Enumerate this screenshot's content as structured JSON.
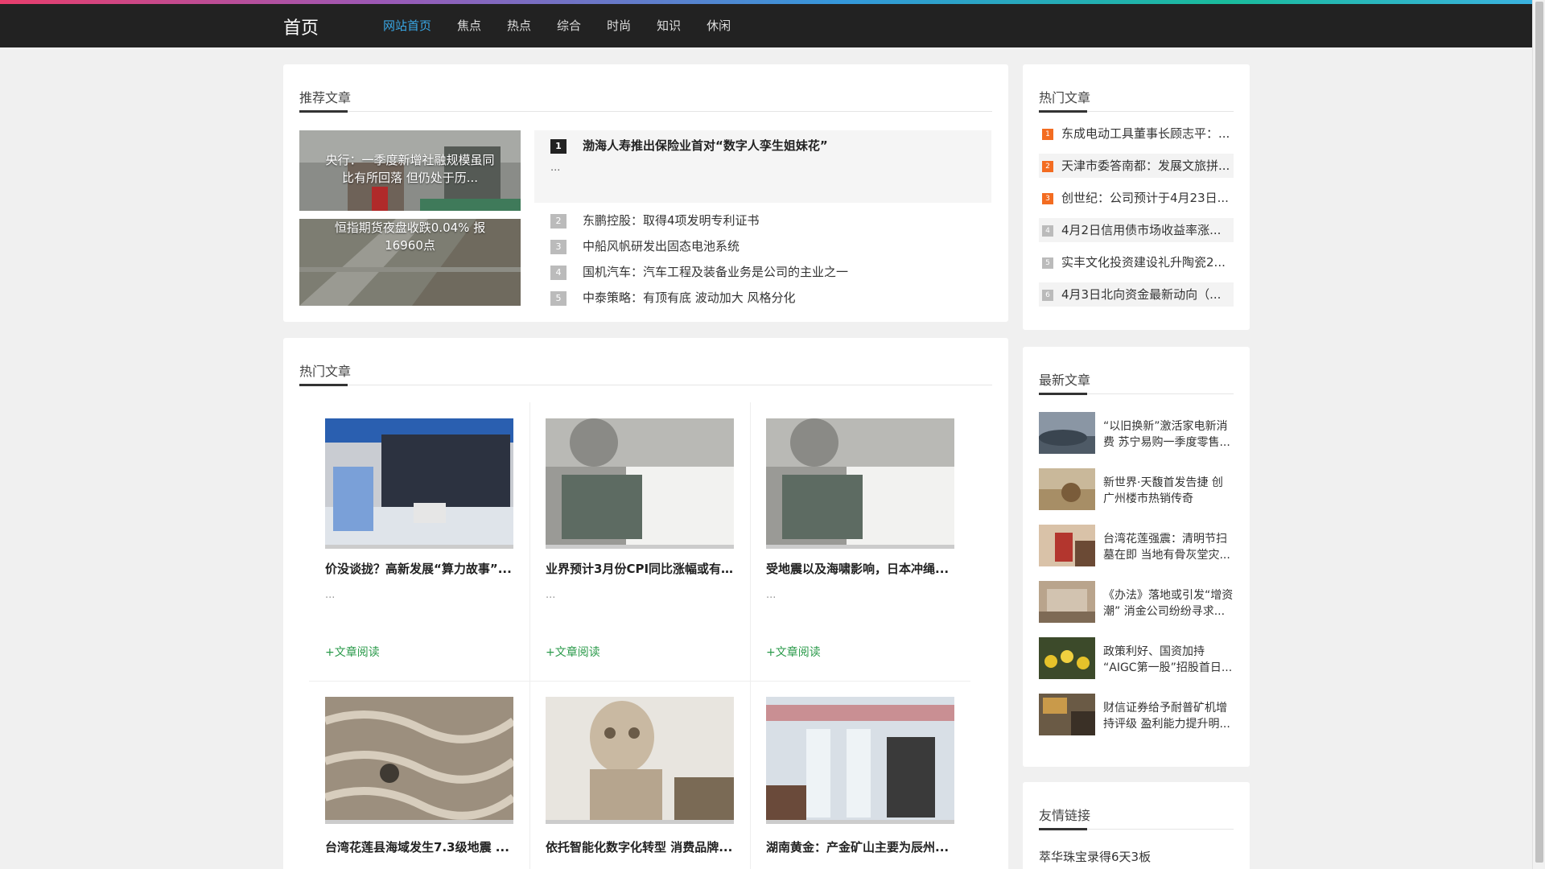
{
  "header": {
    "logo": "首页",
    "nav": [
      "网站首页",
      "焦点",
      "热点",
      "综合",
      "时尚",
      "知识",
      "休闲"
    ]
  },
  "recommend": {
    "title": "推荐文章",
    "images": [
      {
        "caption": "央行：一季度新增社融规模虽同比有所回落 但仍处于历..."
      },
      {
        "caption": "恒指期货夜盘收跌0.04% 报16960点"
      }
    ],
    "first": {
      "num": "1",
      "title": "渤海人寿推出保险业首对“数字人孪生姐妹花”",
      "desc": "..."
    },
    "items": [
      {
        "num": "2",
        "title": "东鹏控股：取得4项发明专利证书"
      },
      {
        "num": "3",
        "title": "中船风帆研发出固态电池系统"
      },
      {
        "num": "4",
        "title": "国机汽车：汽车工程及装备业务是公司的主业之一"
      },
      {
        "num": "5",
        "title": "中泰策略：有顶有底 波动加大 风格分化"
      }
    ]
  },
  "hot": {
    "title": "热门文章",
    "more_label": "+文章阅读",
    "cards": [
      {
        "title": "价没谈拢？高新发展“算力故事”...",
        "desc": "..."
      },
      {
        "title": "业界预计3月份CPI同比涨幅或有...",
        "desc": "..."
      },
      {
        "title": "受地震以及海啸影响，日本冲绳...",
        "desc": "..."
      },
      {
        "title": "台湾花莲县海域发生7.3级地震 ...",
        "desc": ""
      },
      {
        "title": "依托智能化数字化转型 消费品牌...",
        "desc": ""
      },
      {
        "title": "湖南黄金：产金矿山主要为辰州...",
        "desc": ""
      }
    ]
  },
  "side_hot": {
    "title": "热门文章",
    "items": [
      {
        "num": "1",
        "title": "东成电动工具董事长顾志平：..."
      },
      {
        "num": "2",
        "title": "天津市委答南都：发展文旅拼..."
      },
      {
        "num": "3",
        "title": "创世纪：公司预计于4月23日..."
      },
      {
        "num": "4",
        "title": "4月2日信用债市场收益率涨..."
      },
      {
        "num": "5",
        "title": "实丰文化投资建设礼升陶瓷2..."
      },
      {
        "num": "6",
        "title": "4月3日北向资金最新动向（..."
      }
    ]
  },
  "latest": {
    "title": "最新文章",
    "items": [
      {
        "title": "“以旧换新”激活家电新消费 苏宁易购一季度零售..."
      },
      {
        "title": "新世界·天馥首发告捷 创广州楼市热销传奇"
      },
      {
        "title": "台湾花莲强震：清明节扫墓在即 当地有骨灰堂灾..."
      },
      {
        "title": "《办法》落地或引发“增资潮” 消金公司纷纷寻求..."
      },
      {
        "title": "政策利好、国资加持 “AIGC第一股”招股首日..."
      },
      {
        "title": "财信证券给予耐普矿机增持评级 盈利能力提升明..."
      }
    ]
  },
  "links": {
    "title": "友情链接",
    "items": [
      "萃华珠宝录得6天3板"
    ]
  },
  "colors": {
    "accent": "#39a8e6",
    "header_bg": "#222222",
    "badge_orange": "#f36c21",
    "more_green": "#2a9a4a"
  }
}
